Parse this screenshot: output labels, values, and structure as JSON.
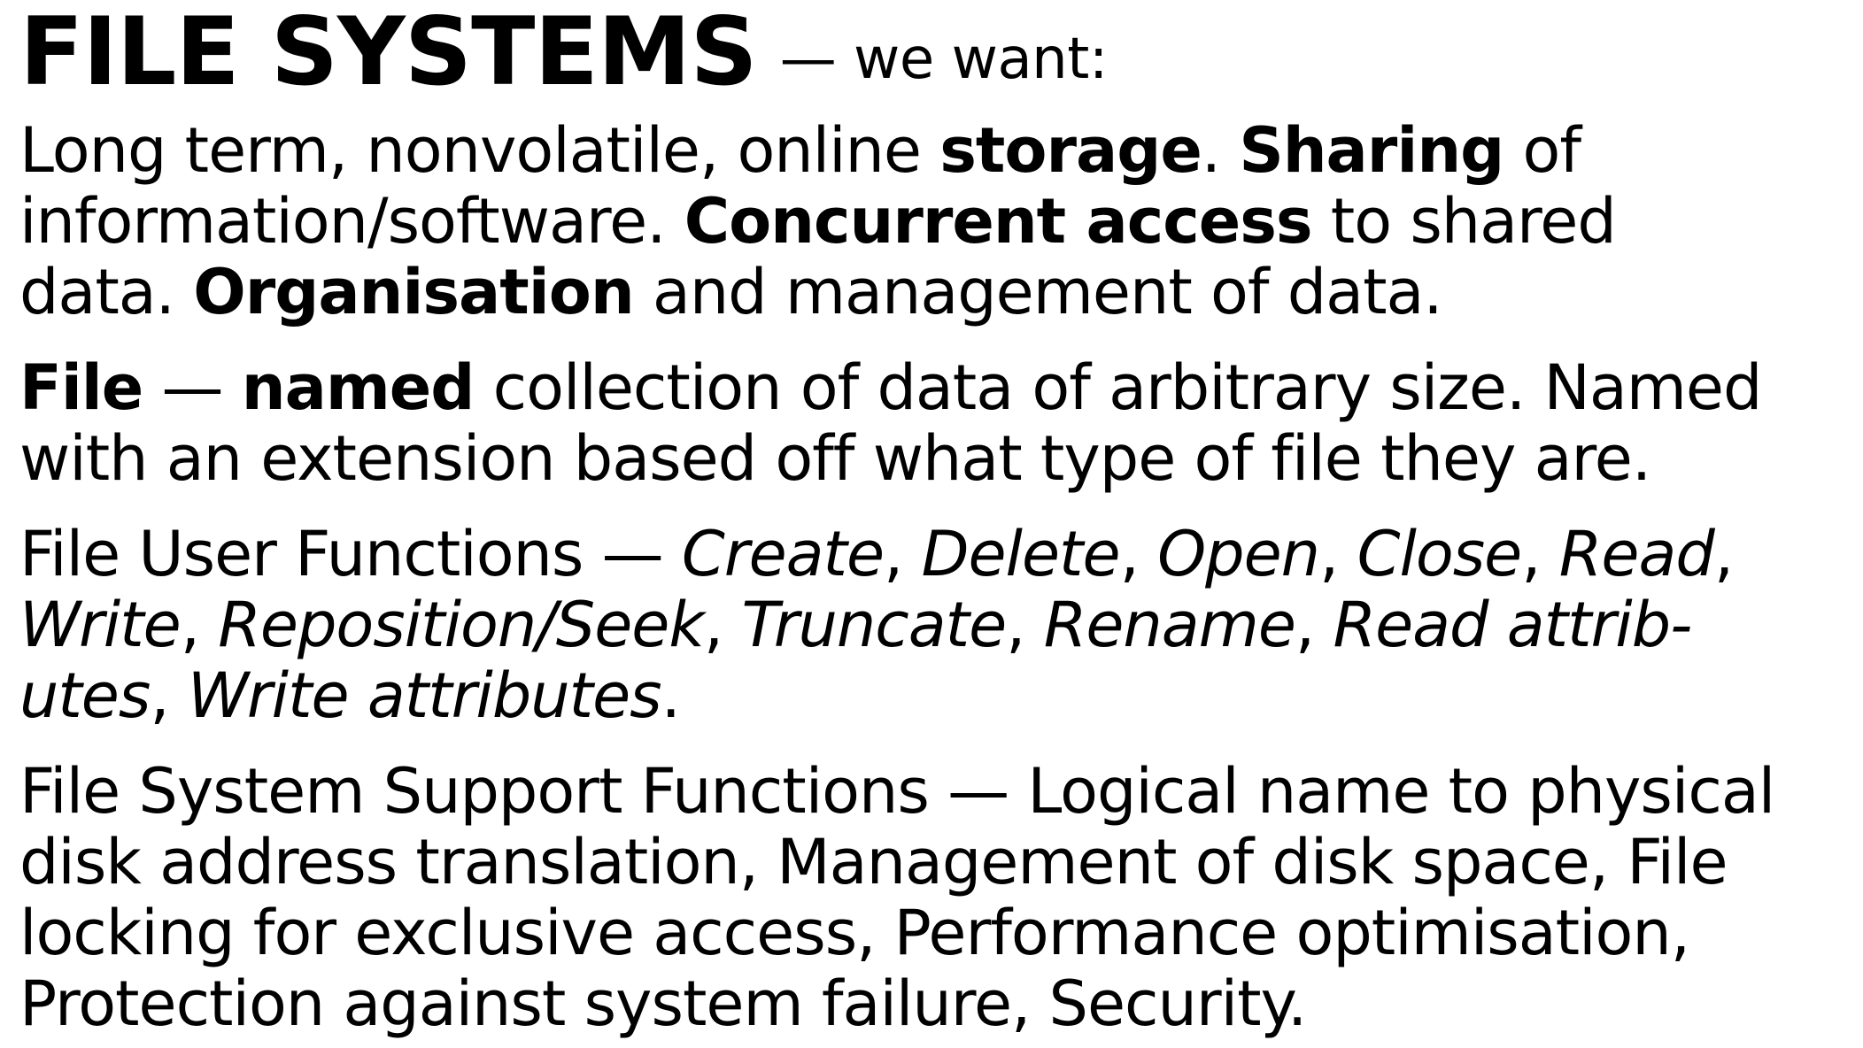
{
  "slide": {
    "title": "FILE SYSTEMS",
    "title_suffix": "— we want:",
    "intro": {
      "l1_a": "Long term, nonvolatile, online ",
      "l1_b": "storage",
      "l1_c": ". ",
      "l1_d": "Sharing",
      "l1_e": " of",
      "l2_a": "information/software. ",
      "l2_b": "Concurrent access",
      "l2_c": " to shared",
      "l3_a": "data. ",
      "l3_b": "Organisation",
      "l3_c": " and management of data."
    },
    "file_def": {
      "l1_a": "File",
      "l1_b": " — ",
      "l1_c": "named",
      "l1_d": " collection of data of arbitrary size. Named",
      "l2": "with an extension based off what type of file they are."
    },
    "user_functions": {
      "l1_a": "File User Functions — ",
      "l1_b": "Create",
      "l1_c": ", ",
      "l1_d": "Delete",
      "l1_e": ", ",
      "l1_f": "Open",
      "l1_g": ", ",
      "l1_h": "Close",
      "l1_i": ", ",
      "l1_j": "Read",
      "l1_k": ",",
      "l2_a": "Write",
      "l2_b": ", ",
      "l2_c": "Reposition/Seek",
      "l2_d": ", ",
      "l2_e": "Truncate",
      "l2_f": ", ",
      "l2_g": "Rename",
      "l2_h": ", ",
      "l2_i": "Read attrib-",
      "l3_a": "utes",
      "l3_b": ", ",
      "l3_c": "Write attributes",
      "l3_d": "."
    },
    "support_functions": {
      "l1": "File System Support Functions — Logical name to physical",
      "l2": "disk address translation, Management of disk space, File",
      "l3": "locking for exclusive access, Performance optimisation,",
      "l4": "Protection against system failure, Security."
    }
  }
}
